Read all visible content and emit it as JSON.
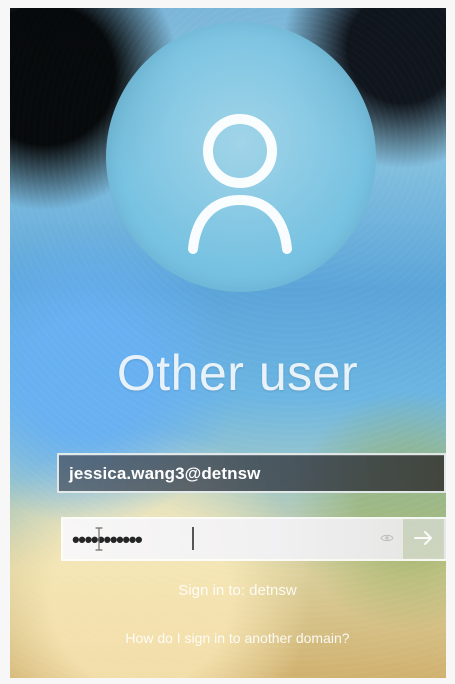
{
  "screen": {
    "title": "Other user",
    "email_value": "jessica.wang3@detnsw",
    "password_mask": "•••••••••••",
    "sign_in_to": "Sign in to: detnsw",
    "help_link": "How do I sign in to another domain?",
    "icons": {
      "avatar": "user-avatar-icon",
      "reveal": "eye-icon",
      "submit": "arrow-right-icon",
      "text_cursor": "text-cursor-icon"
    },
    "colors": {
      "overlay_text": "#f7fbfd",
      "field_border": "#eef4f4",
      "email_bg": "#474f58",
      "password_bg": "#f3f2f4"
    }
  }
}
